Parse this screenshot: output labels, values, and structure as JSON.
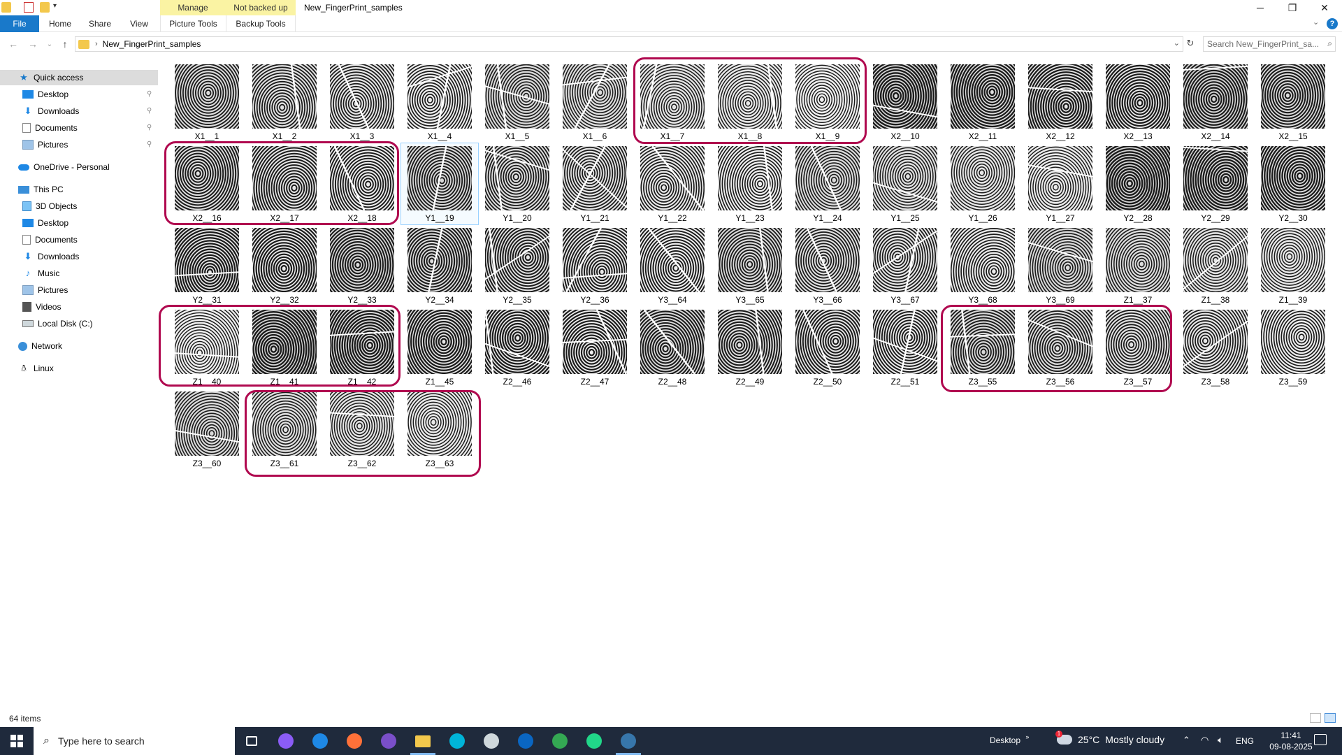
{
  "window": {
    "title": "New_FingerPrint_samples",
    "contextual_tabs": [
      {
        "group": "Manage",
        "tab": "Picture Tools"
      },
      {
        "group": "Not backed up",
        "tab": "Backup Tools"
      }
    ],
    "controls": {
      "minimize": "─",
      "restore": "❐",
      "close": "✕"
    }
  },
  "ribbon": {
    "tabs": [
      "File",
      "Home",
      "Share",
      "View"
    ]
  },
  "address": {
    "path_segment": "New_FingerPrint_samples",
    "search_placeholder": "Search New_FingerPrint_sa...",
    "icons": [
      "back-arrow-icon",
      "forward-arrow-icon",
      "recent-dropdown-icon",
      "up-arrow-icon",
      "folder-icon",
      "refresh-icon",
      "search-icon"
    ]
  },
  "nav": {
    "quick_access": "Quick access",
    "quick_items": [
      "Desktop",
      "Downloads",
      "Documents",
      "Pictures"
    ],
    "onedrive": "OneDrive - Personal",
    "this_pc": "This PC",
    "pc_items": [
      "3D Objects",
      "Desktop",
      "Documents",
      "Downloads",
      "Music",
      "Pictures",
      "Videos",
      "Local Disk (C:)"
    ],
    "network": "Network",
    "linux": "Linux"
  },
  "files": [
    "X1__1",
    "X1__2",
    "X1__3",
    "X1__4",
    "X1__5",
    "X1__6",
    "X1__7",
    "X1__8",
    "X1__9",
    "X2__10",
    "X2__11",
    "X2__12",
    "X2__13",
    "X2__14",
    "X2__15",
    "X2__16",
    "X2__17",
    "X2__18",
    "Y1__19",
    "Y1__20",
    "Y1__21",
    "Y1__22",
    "Y1__23",
    "Y1__24",
    "Y1__25",
    "Y1__26",
    "Y1__27",
    "Y2__28",
    "Y2__29",
    "Y2__30",
    "Y2__31",
    "Y2__32",
    "Y2__33",
    "Y2__34",
    "Y2__35",
    "Y2__36",
    "Y3__64",
    "Y3__65",
    "Y3__66",
    "Y3__67",
    "Y3__68",
    "Y3__69",
    "Z1__37",
    "Z1__38",
    "Z1__39",
    "Z1__40",
    "Z1__41",
    "Z1__42",
    "Z1__45",
    "Z2__46",
    "Z2__47",
    "Z2__48",
    "Z2__49",
    "Z2__50",
    "Z2__51",
    "Z3__55",
    "Z3__56",
    "Z3__57",
    "Z3__58",
    "Z3__59",
    "Z3__60",
    "Z3__61",
    "Z3__62",
    "Z3__63"
  ],
  "selected_file": "Y1__19",
  "highlight_color": "#b0094f",
  "status": {
    "item_count": "64 items"
  },
  "taskbar": {
    "search_placeholder": "Type here to search",
    "apps": [
      "task-view-icon",
      "copilot-icon",
      "edge-icon",
      "firefox-icon",
      "app-icon",
      "file-explorer-icon",
      "canva-icon",
      "unity-icon",
      "outlook-icon",
      "chrome-icon",
      "pycharm-icon",
      "python-icon"
    ],
    "desktop_label": "Desktop",
    "weather_temp": "25°C",
    "weather_text": "Mostly cloudy",
    "language": "ENG",
    "time": "11:41",
    "date": "09-08-2025",
    "notification_count": "1"
  }
}
